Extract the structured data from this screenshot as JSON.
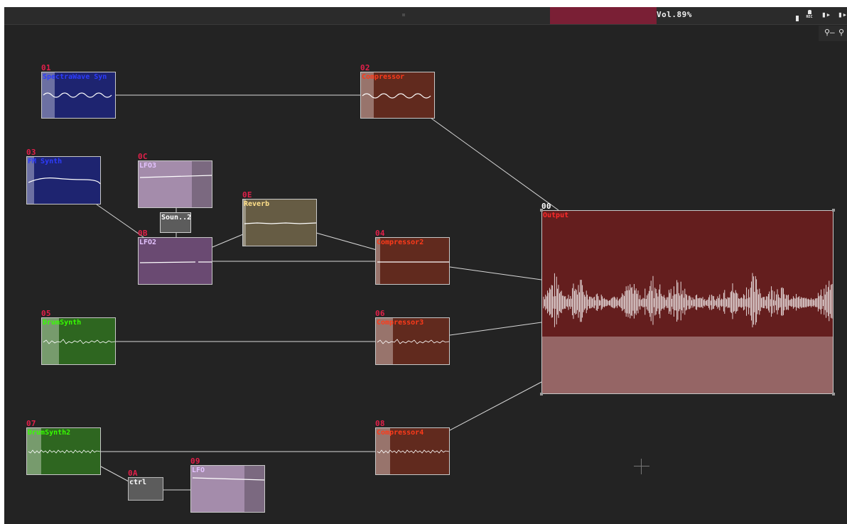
{
  "topbar": {
    "volume_label": "Vol.89%",
    "rec_label": "REC",
    "play_icon": "play-icon",
    "key_icons": [
      "key-icon",
      "key-icon"
    ]
  },
  "colors": {
    "synth_blue": "#1e2470",
    "compressor_brown": "#612a1e",
    "lfo_purple": "#a48cab",
    "reverb_tan": "#665c44",
    "drum_green": "#2e6620",
    "output_red": "#641e1e",
    "output_lower": "#956565",
    "volume_meter": "#7a1f35"
  },
  "nodes": {
    "n01": {
      "id": "01",
      "title": "SpectraWave Syn"
    },
    "n02": {
      "id": "02",
      "title": "Compressor"
    },
    "n03": {
      "id": "03",
      "title": "FM Synth"
    },
    "n0c": {
      "id": "0C",
      "title": "LFO3"
    },
    "n0d": {
      "title": "Soun..2"
    },
    "n0e": {
      "id": "0E",
      "title": "Reverb"
    },
    "n0b": {
      "id": "0B",
      "title": "LFO2"
    },
    "n04": {
      "id": "04",
      "title": "Compressor2"
    },
    "n05": {
      "id": "05",
      "title": "DrumSynth"
    },
    "n06": {
      "id": "06",
      "title": "Compressor3"
    },
    "n07": {
      "id": "07",
      "title": "DrumSynth2"
    },
    "n08": {
      "id": "08",
      "title": "Compressor4"
    },
    "n0a": {
      "id": "0A",
      "title": "ctrl"
    },
    "n09": {
      "id": "09",
      "title": "LFO"
    },
    "n00": {
      "id": "00",
      "title": "Output"
    }
  }
}
